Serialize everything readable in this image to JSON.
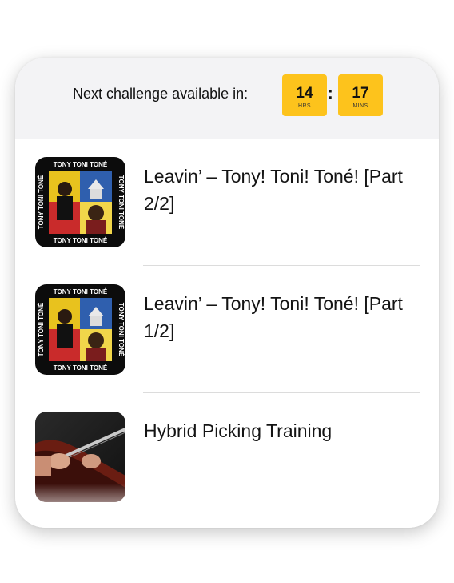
{
  "challenge": {
    "label": "Next challenge available in:",
    "hours": "14",
    "hours_unit": "HRS",
    "separator": ":",
    "minutes": "17",
    "minutes_unit": "MINS"
  },
  "lessons": [
    {
      "title": "Leavin’ – Tony! Toni! Toné! [Part 2/2]",
      "art_text": "TONY TONI TONÉ"
    },
    {
      "title": "Leavin’ – Tony! Toni! Toné! [Part 1/2]",
      "art_text": "TONY TONI TONÉ"
    },
    {
      "title": "Hybrid Picking Training"
    }
  ],
  "colors": {
    "timer_bg": "#fdc31c",
    "header_bg": "#f3f3f5"
  }
}
